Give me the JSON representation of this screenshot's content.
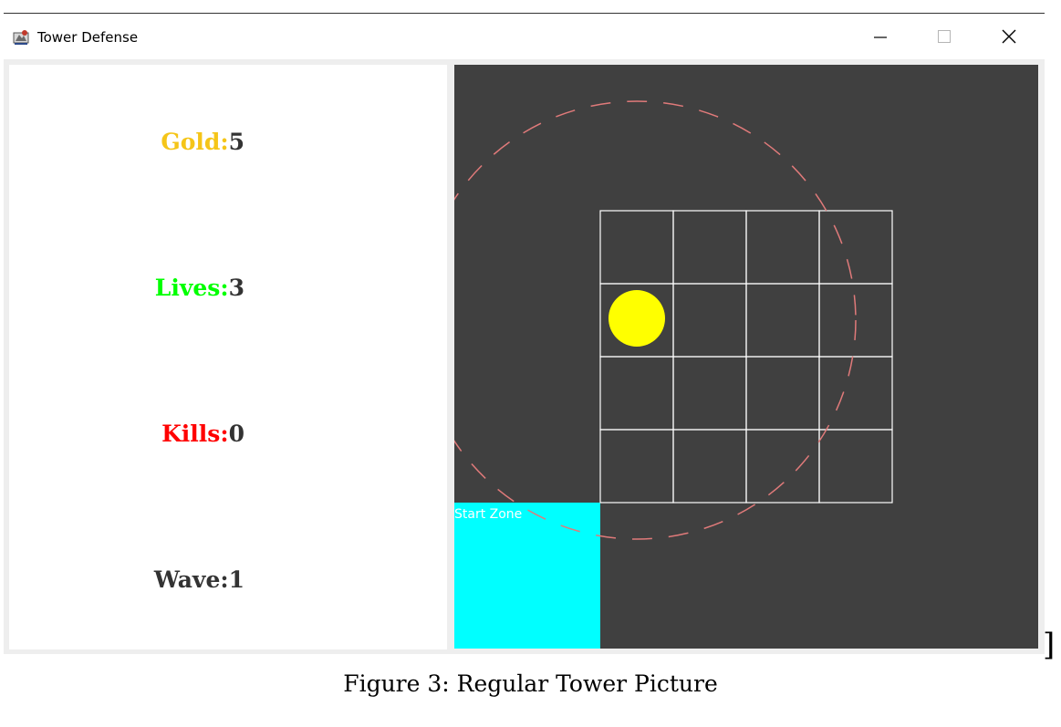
{
  "window": {
    "title": "Tower Defense",
    "controls": {
      "minimize": "minimize-icon",
      "maximize": "maximize-icon",
      "close": "close-icon"
    }
  },
  "stats": {
    "gold": {
      "label": "Gold:",
      "value": "5",
      "color": "#f5c518"
    },
    "lives": {
      "label": "Lives:",
      "value": "3",
      "color": "#00ff00"
    },
    "kills": {
      "label": "Kills:",
      "value": "0",
      "color": "#ff0000"
    },
    "wave": {
      "label": "Wave:",
      "value": "1",
      "color": "#333333"
    }
  },
  "board": {
    "background": "#404040",
    "grid_rows": 4,
    "grid_cols": 4,
    "grid_line_color": "#ffffff",
    "tower": {
      "color": "#ffff00",
      "row": 2,
      "col": 1
    },
    "range_ring_color": "#e07a7a",
    "start_zone": {
      "label": "Start Zone",
      "color": "#00ffff"
    }
  },
  "page": {
    "bracket": "]",
    "caption": "Figure 3: Regular Tower Picture"
  }
}
